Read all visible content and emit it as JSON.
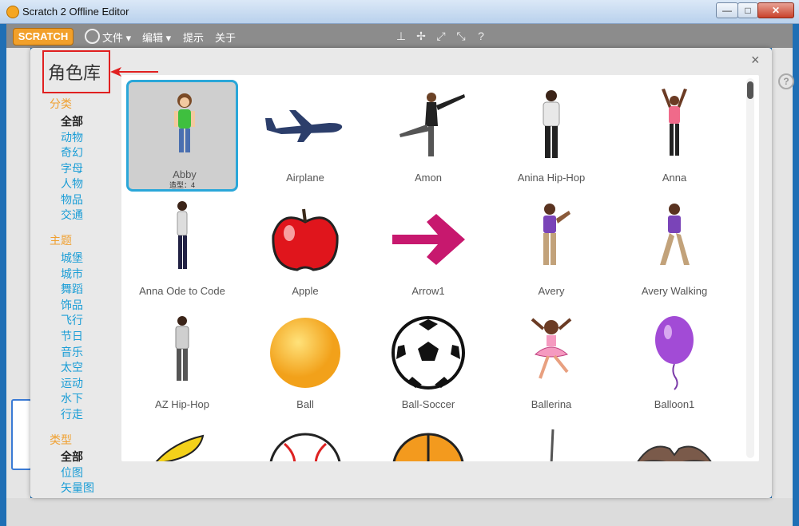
{
  "window": {
    "title": "Scratch 2 Offline Editor",
    "min": "—",
    "max": "□",
    "close": "✕"
  },
  "menubar": {
    "logo": "SCRATCH",
    "items": [
      "文件 ▾",
      "编辑 ▾",
      "提示",
      "关于"
    ]
  },
  "dialog": {
    "title": "角色库",
    "close": "×",
    "categories": {
      "head": "分类",
      "items": [
        "全部",
        "动物",
        "奇幻",
        "字母",
        "人物",
        "物品",
        "交通"
      ]
    },
    "themes": {
      "head": "主题",
      "items": [
        "城堡",
        "城市",
        "舞蹈",
        "饰品",
        "飞行",
        "节日",
        "音乐",
        "太空",
        "运动",
        "水下",
        "行走"
      ]
    },
    "types": {
      "head": "类型",
      "items": [
        "全部",
        "位图",
        "矢量图"
      ]
    },
    "sprites": [
      {
        "name": "Abby",
        "sub": "造型：4"
      },
      {
        "name": "Airplane"
      },
      {
        "name": "Amon"
      },
      {
        "name": "Anina Hip-Hop"
      },
      {
        "name": "Anna"
      },
      {
        "name": "Anna Ode to Code"
      },
      {
        "name": "Apple"
      },
      {
        "name": "Arrow1"
      },
      {
        "name": "Avery"
      },
      {
        "name": "Avery Walking"
      },
      {
        "name": "AZ Hip-Hop"
      },
      {
        "name": "Ball"
      },
      {
        "name": "Ball-Soccer"
      },
      {
        "name": "Ballerina"
      },
      {
        "name": "Balloon1"
      }
    ]
  },
  "colors": {
    "accent": "#2aa7d9",
    "category_head": "#f0a030",
    "link": "#1a9dd6",
    "annotation": "#e02020"
  }
}
